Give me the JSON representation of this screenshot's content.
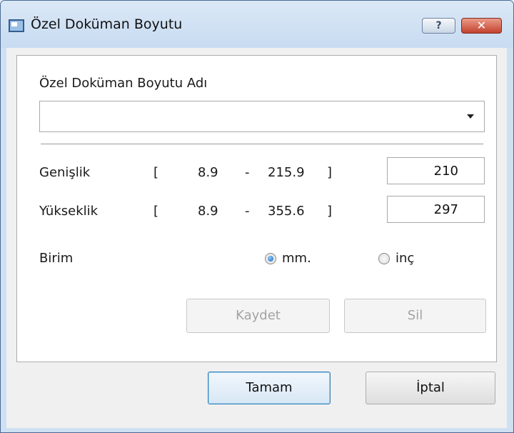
{
  "window": {
    "title": "Özel Doküman Boyutu",
    "help_glyph": "?",
    "close_glyph": "✕"
  },
  "form": {
    "name_label": "Özel Doküman Boyutu Adı",
    "name_value": "",
    "width": {
      "label": "Genişlik",
      "open_bracket": "[",
      "min": "8.9",
      "dash": "-",
      "max": "215.9",
      "close_bracket": "]",
      "value": "210"
    },
    "height": {
      "label": "Yükseklik",
      "open_bracket": "[",
      "min": "8.9",
      "dash": "-",
      "max": "355.6",
      "close_bracket": "]",
      "value": "297"
    },
    "unit": {
      "label": "Birim",
      "options": [
        "mm.",
        "inç"
      ],
      "selected": "mm."
    },
    "save_label": "Kaydet",
    "delete_label": "Sil"
  },
  "footer": {
    "ok_label": "Tamam",
    "cancel_label": "İptal"
  },
  "icons": {
    "app": "dialog-window-icon",
    "help": "help-icon",
    "close": "close-icon",
    "dropdown": "chevron-down-icon"
  },
  "colors": {
    "titlebar": "#cfe0f3",
    "close_button": "#c3422f",
    "radio_selected": "#1a63b8",
    "default_button_border": "#3c7fb1"
  }
}
